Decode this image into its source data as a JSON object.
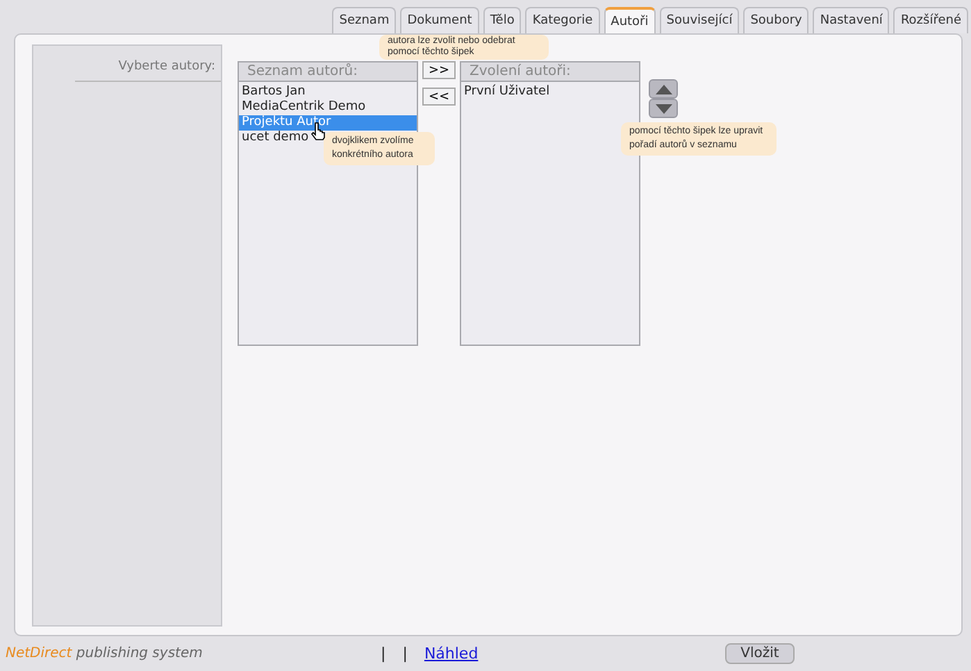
{
  "tabs": [
    {
      "label": "Seznam",
      "selected": false
    },
    {
      "label": "Dokument",
      "selected": false
    },
    {
      "label": "Tělo",
      "selected": false
    },
    {
      "label": "Kategorie",
      "selected": false
    },
    {
      "label": "Autoři",
      "selected": true
    },
    {
      "label": "Související",
      "selected": false
    },
    {
      "label": "Soubory",
      "selected": false
    },
    {
      "label": "Nastavení",
      "selected": false
    },
    {
      "label": "Rozšířené",
      "selected": false
    }
  ],
  "form_label": "Vyberte autory:",
  "available": {
    "heading": "Seznam autorů:",
    "items": [
      {
        "label": "Bartos Jan",
        "selected": false
      },
      {
        "label": "MediaCentrik Demo",
        "selected": false
      },
      {
        "label": "Projektu Autor",
        "selected": true
      },
      {
        "label": "ucet demo",
        "selected": false
      }
    ]
  },
  "move_buttons": [
    ">>",
    "<<"
  ],
  "chosen": {
    "heading": "Zvolení autoři:",
    "items": [
      {
        "label": "První Uživatel",
        "selected": false
      }
    ]
  },
  "tooltips": {
    "move": "autora lze zvolit nebo odebrat pomocí těchto šipek",
    "double_click": "dvojklikem zvolíme konkrétního autora",
    "order": "pomocí těchto šipek lze upravit pořadí autorů v seznamu"
  },
  "footer": {
    "brand": "NetDirect",
    "brand_suffix": "publishing system",
    "separators": [
      "|",
      "|"
    ],
    "preview_link": "Náhled",
    "insert_button": "Vložit"
  }
}
